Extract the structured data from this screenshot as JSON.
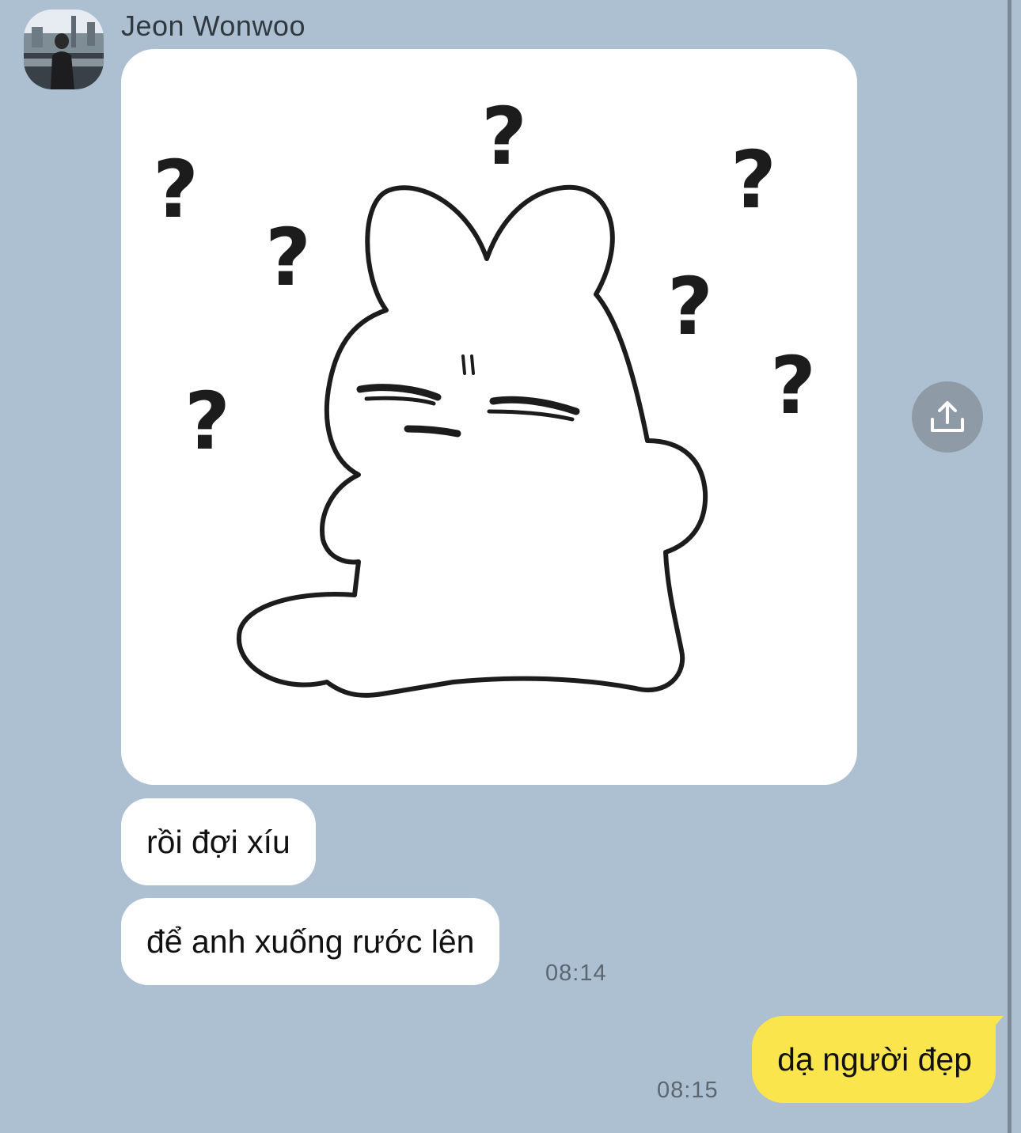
{
  "sender": {
    "name": "Jeon Wonwoo"
  },
  "messages": {
    "incoming": [
      {
        "text": "rồi đợi xíu"
      },
      {
        "text": "để anh xuống rước lên"
      }
    ],
    "incoming_time": "08:14",
    "outgoing": {
      "text": "dạ người đẹp"
    },
    "outgoing_time": "08:15"
  },
  "icons": {
    "share": "share-upload-icon"
  },
  "colors": {
    "background": "#adc0d2",
    "incoming_bubble": "#ffffff",
    "outgoing_bubble": "#fbe54c",
    "share_button": "#8e9aa6"
  }
}
